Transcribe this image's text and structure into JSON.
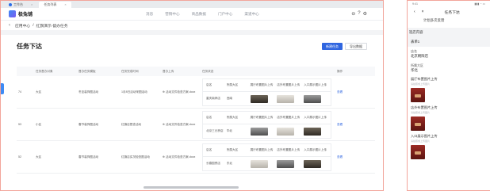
{
  "desktop": {
    "tabs": [
      {
        "label": "工作台",
        "close": "×"
      },
      {
        "label": "任务列表",
        "close": "×"
      }
    ],
    "app_name": "极兔铺",
    "nav": [
      "消息",
      "营销中心",
      "商品数据",
      "门户中心",
      "渠道中心"
    ],
    "nav_icons": [
      "⊖",
      "?",
      "⚙"
    ],
    "breadcrumb": {
      "back": "‹",
      "items": [
        "应用中心",
        "/",
        "红旗演示-督办任务"
      ]
    },
    "page_title": "任务下达",
    "buttons": {
      "primary": "新建任务",
      "secondary": "导出数据"
    },
    "columns": [
      "",
      "任务督办对象",
      "督办任务模板",
      "任务完成时间",
      "督办上传",
      "任务状态",
      "操作"
    ],
    "sub_columns": [
      "店名",
      "所属大区",
      "展厅布置图片上传",
      "店外布置图片上传",
      "入口展示图片上传"
    ],
    "rows": [
      {
        "id": "74",
        "target": "大区",
        "template": "冬至装饰图活动",
        "time": "1月8日活动采图活动",
        "file": "⊕ 活动文件检查方案.docx",
        "store": "重庆南岸店",
        "region": "西南",
        "thumbs": [
          "dark",
          "light",
          "mid"
        ],
        "op": "查看"
      },
      {
        "id": "53",
        "target": "小区",
        "template": "春节装饰图活动",
        "time": "红旗店督查活动",
        "file": "⊕ 活动文件检查方案.docx",
        "store": "北京三元桥店",
        "region": "华北",
        "thumbs": [
          "mid",
          "light",
          "dark"
        ],
        "op": "查看"
      },
      {
        "id": "52",
        "target": "大区",
        "template": "春节装饰图活动",
        "time": "红旗店实况检查图活动",
        "file": "⊕ 活动文件检查方案.docx",
        "store": "长春国贸店",
        "region": "东北",
        "thumbs": [
          "light",
          "mid",
          "dark"
        ],
        "op": "查看"
      }
    ]
  },
  "mobile": {
    "status_time": "9:41",
    "status_right": "▮▮▮ ◔ ▭",
    "back": "‹",
    "close": "×",
    "title": "任务下达",
    "subtitle": "计划多次反馈",
    "section": "巡店内容",
    "fields": [
      {
        "label": "店名",
        "value": "表单1",
        "selected": true
      },
      {
        "label": "店名",
        "value": "北京朝阳店",
        "selected": false
      },
      {
        "label": "所属大区",
        "value": "华北",
        "selected": false
      }
    ],
    "uploads": [
      {
        "title": "展厅布置图片上传",
        "hint": "请拍照或上传图片"
      },
      {
        "title": "店外布置图片上传",
        "hint": "请拍照或上传图片"
      },
      {
        "title": "入口展示图片上传",
        "hint": "请拍照或上传图片"
      }
    ]
  },
  "colors": {
    "accent": "#3066e0",
    "frame": "#f2a59b",
    "photo": "#9b2a24"
  }
}
